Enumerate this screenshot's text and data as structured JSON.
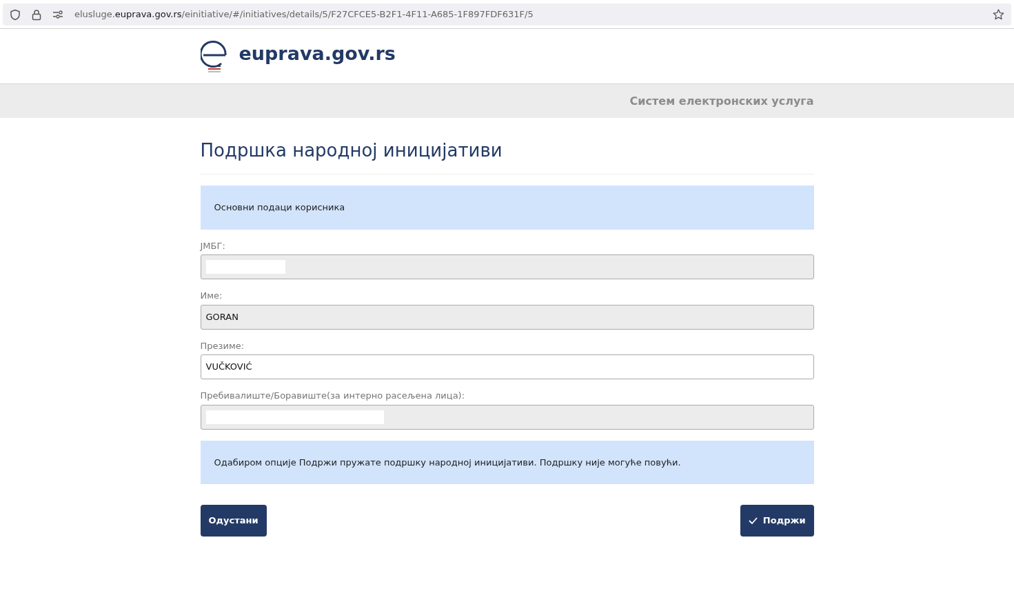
{
  "browser": {
    "url_prefix": "elusluge.",
    "url_domain": "euprava.gov.rs",
    "url_path": "/einitiative/#/initiatives/details/5/F27CFCE5-B2F1-4F11-A685-1F897FDF631F/5"
  },
  "header": {
    "logo_text": "euprava.gov.rs"
  },
  "subheader": {
    "title": "Систем електронских услуга"
  },
  "page": {
    "title": "Подршка народној иницијативи"
  },
  "section_notice": "Основни подаци корисника",
  "fields": [
    {
      "label": "ЈМБГ:",
      "disabled": true,
      "redacted": true
    },
    {
      "label": "Име:",
      "value": "GORAN",
      "disabled": true,
      "redacted": false
    },
    {
      "label": "Презиме:",
      "value": "VUČKOVIĆ",
      "disabled": false,
      "redacted": false
    },
    {
      "label": "Пребивалиште/Боравиште(за интерно расељена лица):",
      "disabled": true,
      "redacted": true
    }
  ],
  "info_notice": "Одабиром опције Подржи пружате подршку народној иницијативи. Подршку није могуће повући.",
  "buttons": [
    {
      "label": "Одустани",
      "kind": "cancel"
    },
    {
      "label": "Подржи",
      "kind": "confirm"
    }
  ]
}
